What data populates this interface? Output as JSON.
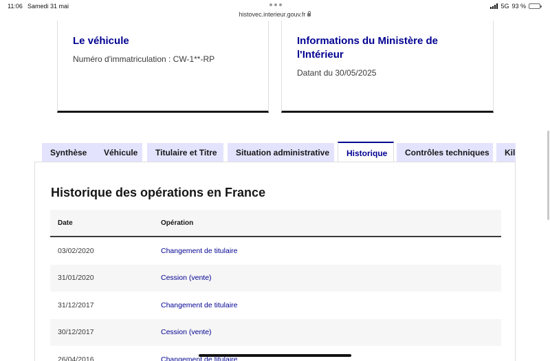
{
  "status_bar": {
    "time": "11:06",
    "date": "Samedi 31 mai",
    "network": "5G",
    "battery": "93 %",
    "battery_level": 0.93
  },
  "browser": {
    "url": "histovec.interieur.gouv.fr"
  },
  "cards": {
    "vehicle": {
      "title": "Le véhicule",
      "detail": "Numéro d'immatriculation : CW-1**-RP"
    },
    "ministry": {
      "title": "Informations du Ministère de l'Intérieur",
      "detail": "Datant du 30/05/2025"
    }
  },
  "tabs": [
    {
      "label": "Synthèse",
      "active": false
    },
    {
      "label": "Véhicule",
      "active": false
    },
    {
      "label": "Titulaire et Titre",
      "active": false
    },
    {
      "label": "Situation administrative",
      "active": false
    },
    {
      "label": "Historique",
      "active": true
    },
    {
      "label": "Contrôles techniques",
      "active": false
    },
    {
      "label": "Kilo",
      "active": false
    }
  ],
  "history": {
    "title": "Historique des opérations en France",
    "columns": {
      "date": "Date",
      "operation": "Opération"
    },
    "rows": [
      {
        "date": "03/02/2020",
        "operation": "Changement de titulaire"
      },
      {
        "date": "31/01/2020",
        "operation": "Cession (vente)"
      },
      {
        "date": "31/12/2017",
        "operation": "Changement de titulaire"
      },
      {
        "date": "30/12/2017",
        "operation": "Cession (vente)"
      },
      {
        "date": "26/04/2016",
        "operation": "Changement de titulaire"
      }
    ]
  }
}
